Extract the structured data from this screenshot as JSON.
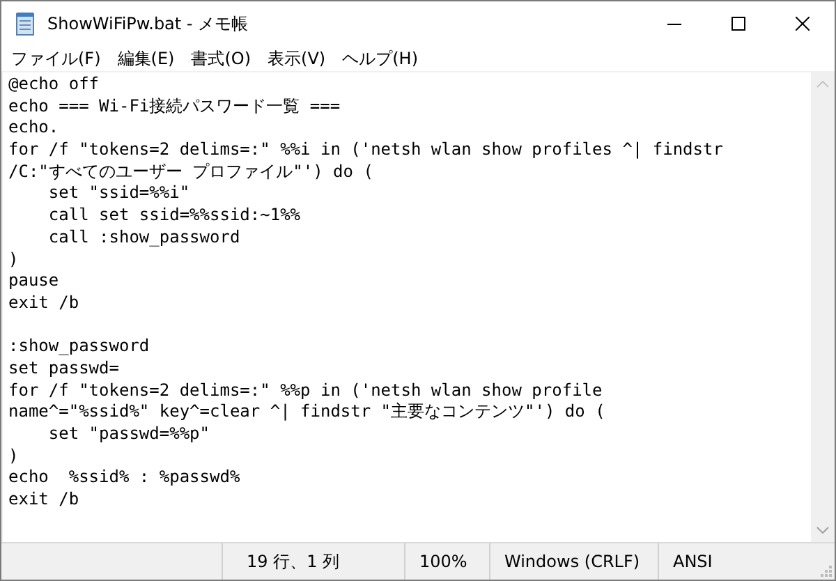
{
  "window": {
    "title": "ShowWiFiPw.bat - メモ帳"
  },
  "menu": [
    "ファイル(F)",
    "編集(E)",
    "書式(O)",
    "表示(V)",
    "ヘルプ(H)"
  ],
  "editor": {
    "blocks": [
      [
        "@echo off",
        "echo === Wi-Fi接続パスワード一覧 ===",
        "echo.",
        "for /f \"tokens=2 delims=:\" %%i in ('netsh wlan show profiles ^| findstr",
        "/C:\"すべてのユーザー プロファイル\"') do (",
        "    set \"ssid=%%i\"",
        "    call set ssid=%%ssid:~1%%",
        "    call :show_password",
        ")",
        "pause",
        "exit /b"
      ],
      [
        ":show_password",
        "set passwd=",
        "for /f \"tokens=2 delims=:\" %%p in ('netsh wlan show profile",
        "name^=\"%ssid%\" key^=clear ^| findstr \"主要なコンテンツ\"') do (",
        "    set \"passwd=%%p\"",
        ")",
        "echo  %ssid% : %passwd%",
        "exit /b"
      ]
    ]
  },
  "status_bar": {
    "position": "19 行、1 列",
    "zoom": "100%",
    "line_ending": "Windows (CRLF)",
    "encoding": "ANSI"
  }
}
